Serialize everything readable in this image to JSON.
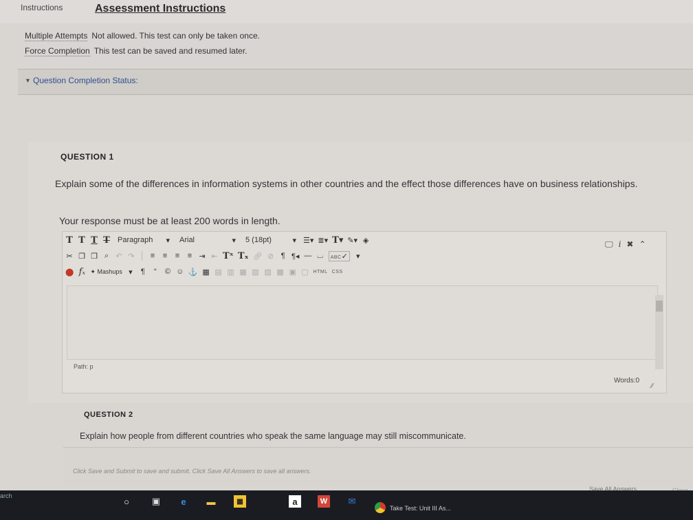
{
  "header": {
    "tab_label": "Instructions",
    "title": "Assessment Instructions"
  },
  "instructions": [
    {
      "label": "Multiple Attempts",
      "value": "Not allowed. This test can only be taken once."
    },
    {
      "label": "Force Completion",
      "value": "This test can be saved and resumed later."
    }
  ],
  "status": {
    "label": "Question Completion Status:"
  },
  "question1": {
    "label": "QUESTION 1",
    "text": "Explain some of the differences in information systems in other countries and the effect those differences have on business relationships.",
    "requirement": "Your response must be at least 200 words in length."
  },
  "editor": {
    "format_select": "Paragraph",
    "font_select": "Arial",
    "size_select": "5 (18pt)",
    "mashups_label": "Mashups",
    "html_tag": "HTML",
    "css_tag": "CSS",
    "spell_tag": "ABC",
    "path_label": "Path: p",
    "words_label": "Words:0"
  },
  "question2": {
    "label": "QUESTION 2",
    "text": "Explain how people from different countries who speak the same language may still miscommunicate."
  },
  "footer": {
    "note": "Click Save and Submit to save and submit. Click Save All Answers to save all answers.",
    "save_all": "Save All Answers",
    "close": "Close"
  },
  "taskbar": {
    "search_text": "arch",
    "chrome_task_label": "Take Test: Unit III As...",
    "amazon_glyph": "a",
    "office_glyph": "W"
  },
  "colors": {
    "taskbar": "#1a1c22",
    "link": "#2f4f8f",
    "chrome_red": "#d23c2a"
  }
}
